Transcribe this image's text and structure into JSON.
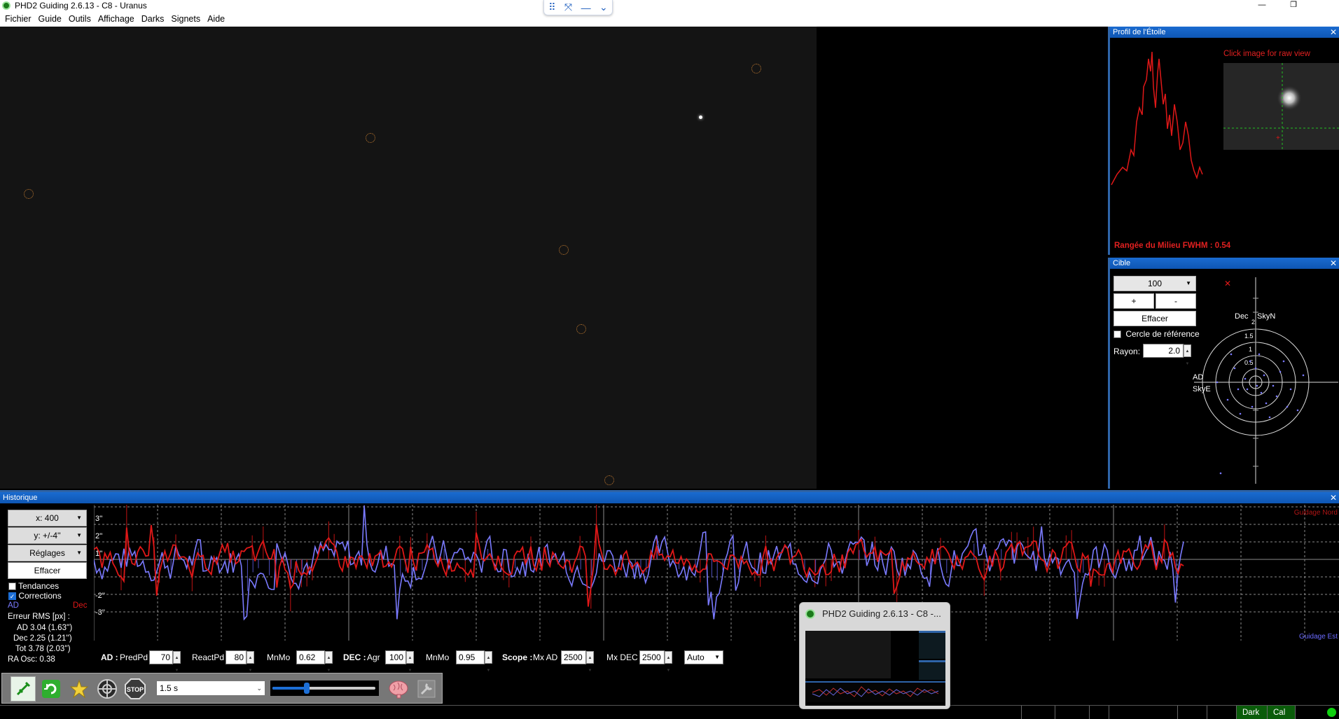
{
  "window": {
    "title": "PHD2 Guiding 2.6.13 - C8 - Uranus",
    "restore_glyph": "❐"
  },
  "menu": [
    "Fichier",
    "Guide",
    "Outils",
    "Affichage",
    "Darks",
    "Signets",
    "Aide"
  ],
  "profile": {
    "header": "Profil de l'Étoile",
    "raw_view_hint": "Click image for raw view",
    "fwhm": "Rangée du Milieu FWHM : 0.54"
  },
  "target": {
    "header": "Cible",
    "zoom": "100",
    "plus": "+",
    "minus": "-",
    "clear": "Effacer",
    "ref_circle": "Cercle de référence",
    "radius_label": "Rayon:",
    "radius": "2.0",
    "axis_labels": {
      "dec": "Dec",
      "skyn": "SkyN",
      "ad": "AD",
      "skye": "SkyE",
      "r2": "2",
      "r15": "1.5",
      "r1": "1",
      "r05": "0.5"
    }
  },
  "history": {
    "header": "Historique",
    "x_scale": "x: 400",
    "y_scale": "y: +/-4''",
    "settings": "Réglages",
    "clear": "Effacer",
    "trends": "Tendances",
    "corrections": "Corrections",
    "legend_ra": "AD",
    "legend_dec": "Dec",
    "rms_title": "Erreur RMS [px] :",
    "rms_ra": "AD 3.04 (1.63'')",
    "rms_dec": "Dec 2.25 (1.21'')",
    "rms_tot": "Tot 3.78 (2.03'')",
    "ra_osc": "RA Osc: 0.38",
    "guide_north": "Guidage Nord",
    "guide_east": "Guidage Est",
    "y_ticks": [
      "3''",
      "2''",
      "1''",
      "-2''",
      "-3''"
    ],
    "colors": {
      "ra": "#7a7aff",
      "dec": "#e01818",
      "grid": "#8a8a8a"
    }
  },
  "params": {
    "ad_label": "AD :",
    "predpd_label": "PredPd",
    "predpd": "70",
    "reactpd_label": "ReactPd",
    "reactpd": "80",
    "mnmo_label": "MnMo",
    "mnmo_ra": "0.62",
    "dec_label": "DEC :",
    "agr_label": "Agr",
    "agr": "100",
    "mnmo_dec_label": "MnMo",
    "mnmo_dec": "0.95",
    "scope_label": "Scope :",
    "mxad_label": "Mx AD",
    "mxad": "2500",
    "mxdec_label": "Mx DEC",
    "mxdec": "2500",
    "mode": "Auto"
  },
  "toolbar": {
    "exposure": "1.5 s",
    "stop": "STOP",
    "slider_fraction": 0.33
  },
  "status": {
    "dark": "Dark",
    "cal": "Cal"
  },
  "thumbnail": {
    "title": "PHD2 Guiding 2.6.13 - C8 -..."
  }
}
